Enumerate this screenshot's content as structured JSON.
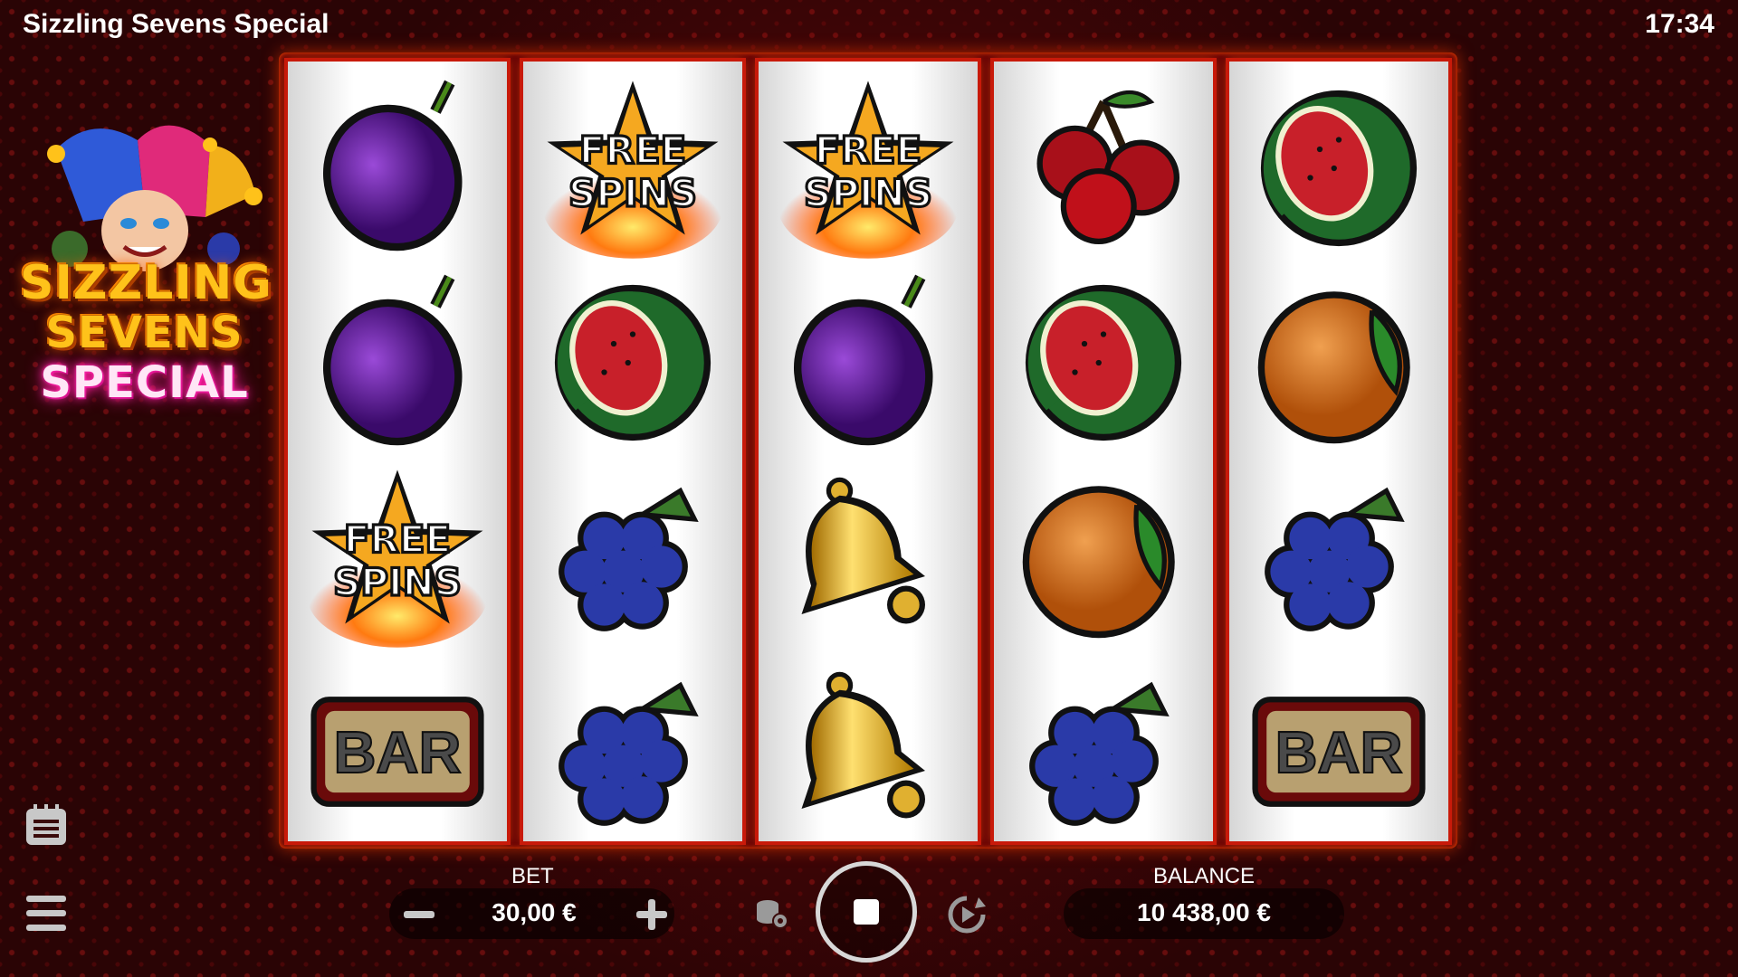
{
  "header": {
    "title": "Sizzling Sevens Special",
    "time": "17:34"
  },
  "logo": {
    "line1": "SIZZLING",
    "line2": "SEVENS",
    "line3": "SPECIAL"
  },
  "reels": [
    [
      "plum",
      "plum",
      "free-spins",
      "bar"
    ],
    [
      "free-spins",
      "watermelon",
      "grapes",
      "grapes"
    ],
    [
      "free-spins",
      "plum",
      "bell",
      "bell"
    ],
    [
      "cherries",
      "watermelon",
      "orange",
      "grapes"
    ],
    [
      "watermelon",
      "orange",
      "grapes",
      "bar"
    ]
  ],
  "symbol_text": {
    "free_line1": "FREE",
    "free_line2": "SPINS",
    "bar": "BAR"
  },
  "controls": {
    "bet_label": "BET",
    "bet_value": "30,00 €",
    "balance_label": "BALANCE",
    "balance_value": "10 438,00 €"
  },
  "colors": {
    "background": "#2a0405",
    "reel_border": "#c81a0a",
    "accent": "#ffc21a"
  }
}
